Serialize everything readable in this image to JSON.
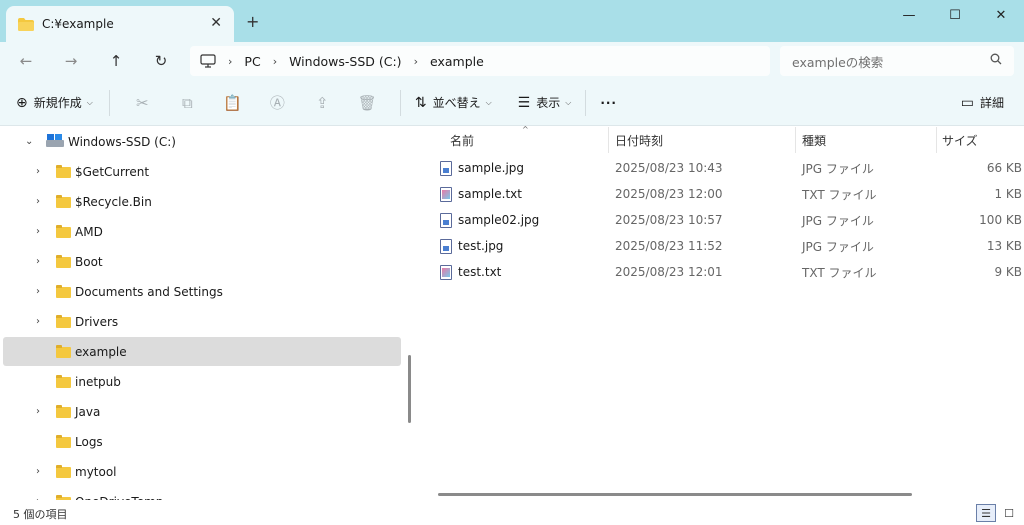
{
  "tab": {
    "title": "C:¥example"
  },
  "window": {
    "minimize": "—",
    "maximize": "☐",
    "close": "✕",
    "new_tab": "+"
  },
  "nav_buttons": {
    "back": "←",
    "forward": "→",
    "up": "↑",
    "refresh": "↻"
  },
  "breadcrumb": {
    "items": [
      "PC",
      "Windows-SSD (C:)",
      "example"
    ],
    "separator": "›"
  },
  "search": {
    "placeholder": "exampleの検索"
  },
  "toolbar": {
    "new_label": "新規作成",
    "sort_label": "並べ替え",
    "view_label": "表示",
    "more_label": "···",
    "details_label": "詳細"
  },
  "tree": {
    "drive": "Windows-SSD (C:)",
    "items": [
      {
        "label": "$GetCurrent",
        "expandable": true
      },
      {
        "label": "$Recycle.Bin",
        "expandable": true
      },
      {
        "label": "AMD",
        "expandable": true
      },
      {
        "label": "Boot",
        "expandable": true
      },
      {
        "label": "Documents and Settings",
        "expandable": true
      },
      {
        "label": "Drivers",
        "expandable": true
      },
      {
        "label": "example",
        "expandable": false,
        "selected": true
      },
      {
        "label": "inetpub",
        "expandable": false
      },
      {
        "label": "Java",
        "expandable": true
      },
      {
        "label": "Logs",
        "expandable": false
      },
      {
        "label": "mytool",
        "expandable": true
      },
      {
        "label": "OneDriveTemp",
        "expandable": true
      }
    ]
  },
  "columns": {
    "name": "名前",
    "date": "日付時刻",
    "type": "種類",
    "size": "サイズ"
  },
  "files": [
    {
      "name": "sample.jpg",
      "date": "2025/08/23 10:43",
      "type": "JPG ファイル",
      "size": "66 KB",
      "kind": "jpg"
    },
    {
      "name": "sample.txt",
      "date": "2025/08/23 12:00",
      "type": "TXT ファイル",
      "size": "1 KB",
      "kind": "txt"
    },
    {
      "name": "sample02.jpg",
      "date": "2025/08/23 10:57",
      "type": "JPG ファイル",
      "size": "100 KB",
      "kind": "jpg"
    },
    {
      "name": "test.jpg",
      "date": "2025/08/23 11:52",
      "type": "JPG ファイル",
      "size": "13 KB",
      "kind": "jpg"
    },
    {
      "name": "test.txt",
      "date": "2025/08/23 12:01",
      "type": "TXT ファイル",
      "size": "9 KB",
      "kind": "txt"
    }
  ],
  "status": {
    "item_count": "5 個の項目"
  },
  "colors": {
    "titlebar": "#a9dfe8",
    "toolbar": "#eef8fa",
    "selection": "#dcdcdc",
    "folder": "#f4c83f"
  }
}
